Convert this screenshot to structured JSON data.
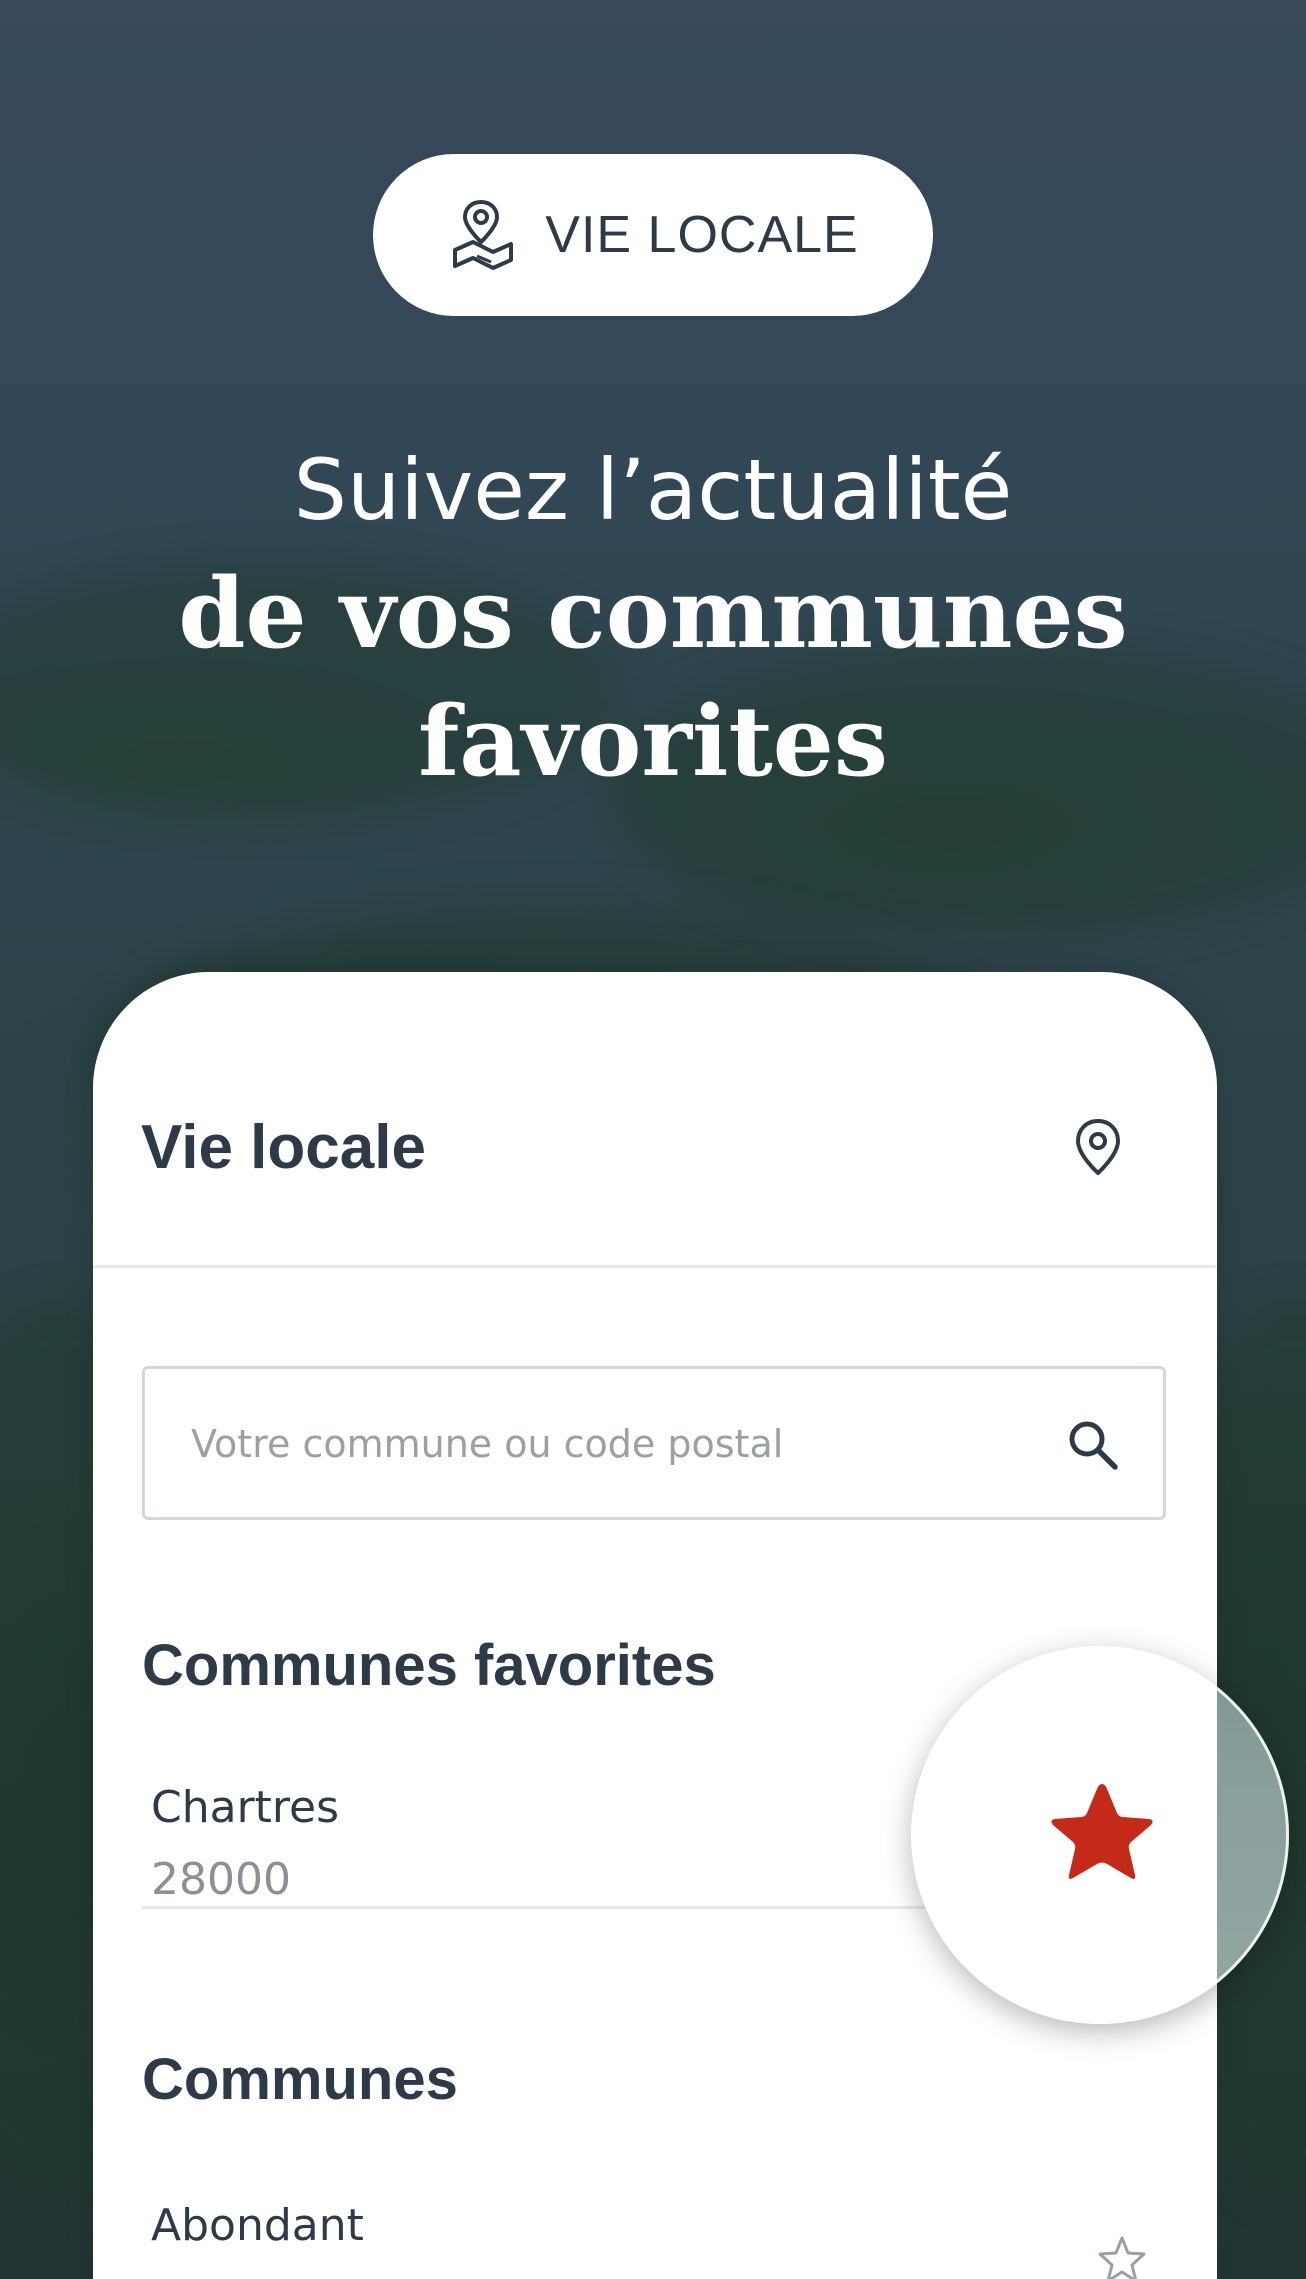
{
  "pill": {
    "icon": "map-pin-newspaper-icon",
    "label": "VIE LOCALE"
  },
  "headline": {
    "line1": "Suivez l’actualité",
    "line2": "de vos communes",
    "line3": "favorites"
  },
  "card": {
    "title": "Vie locale",
    "location_icon": "map-pin-icon",
    "search": {
      "placeholder": "Votre commune ou code postal",
      "value": "",
      "icon": "search-icon"
    },
    "favorites": {
      "title": "Communes favorites",
      "items": [
        {
          "name": "Chartres",
          "code": "28000",
          "favorite": true
        }
      ]
    },
    "communes": {
      "title": "Communes",
      "items": [
        {
          "name": "Abondant",
          "favorite": false
        }
      ]
    }
  },
  "colors": {
    "text_dark": "#2d3a48",
    "text_muted": "#8a9096",
    "favorite_star": "#c42a1a",
    "outline_star": "#9aa0a6",
    "background": "#34485a"
  }
}
